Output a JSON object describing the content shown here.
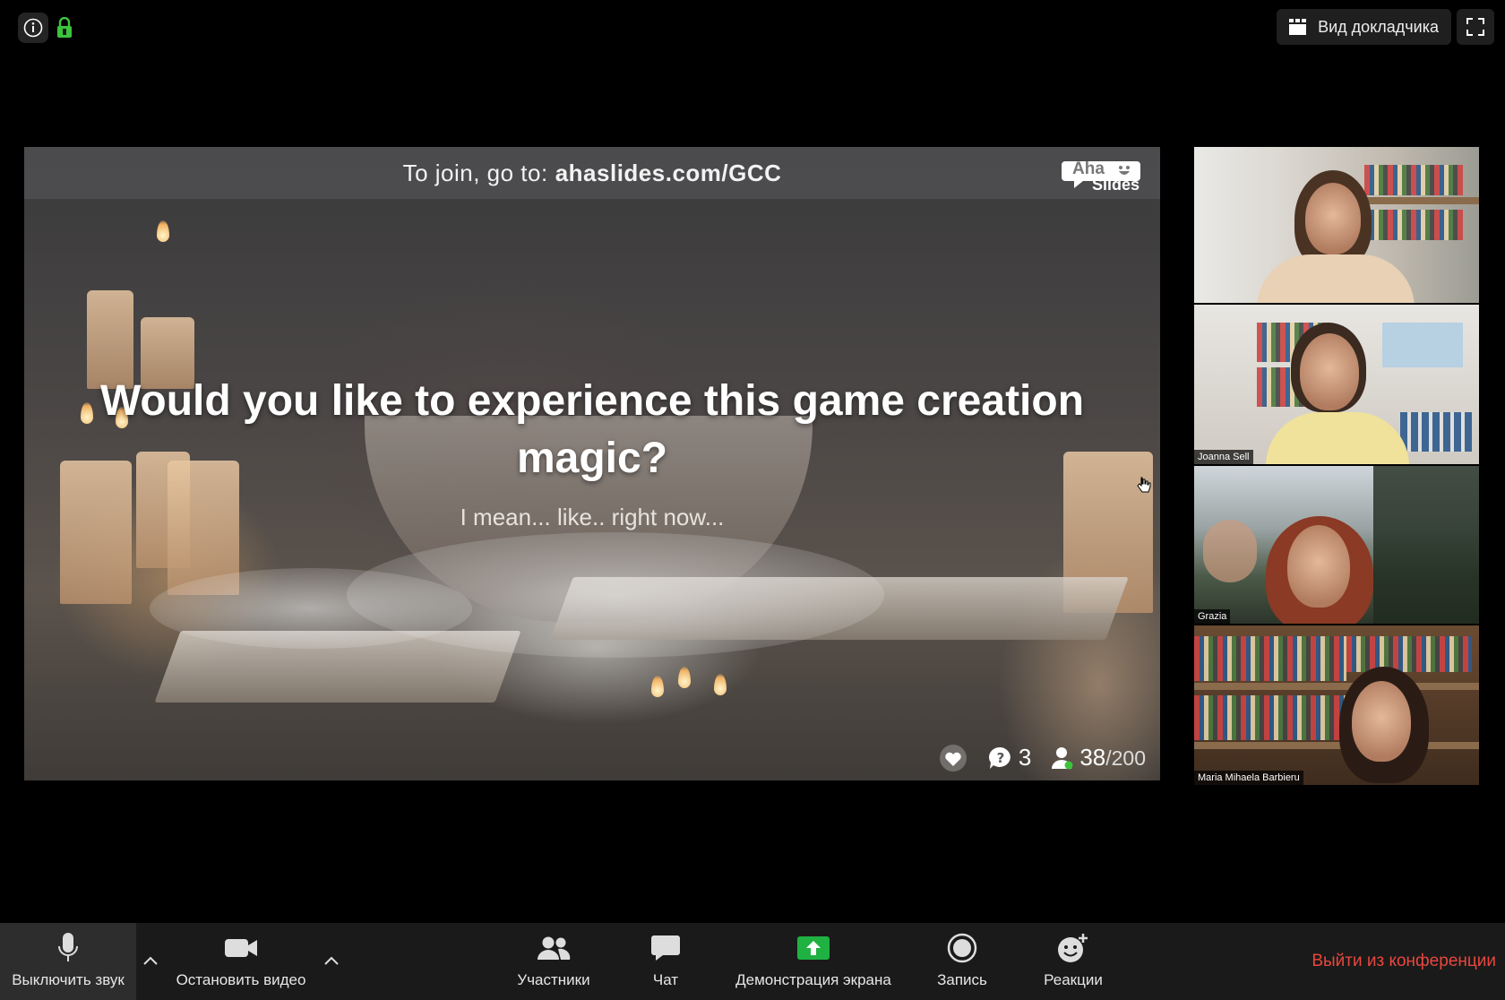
{
  "topbar": {
    "info_icon": "info-icon",
    "lock_icon": "lock-icon",
    "speaker_view_label": "Вид докладчика",
    "fullscreen_icon": "fullscreen-icon"
  },
  "slide": {
    "join_prefix": "To join, go to:",
    "join_url": "ahaslides.com/GCC",
    "logo_line1": "Aha",
    "logo_line2": "Slides",
    "title": "Would you like to experience this game creation magic?",
    "subtitle": "I mean... like.. right now...",
    "questions_count": "3",
    "participants_count": "38",
    "participants_total": "/200"
  },
  "participants": [
    {
      "name": ""
    },
    {
      "name": "Joanna Sell"
    },
    {
      "name": "Grazia"
    },
    {
      "name": "Maria Mihaela Barbieru"
    }
  ],
  "toolbar": {
    "mute_label": "Выключить звук",
    "video_label": "Остановить видео",
    "participants_label": "Участники",
    "chat_label": "Чат",
    "share_label": "Демонстрация экрана",
    "record_label": "Запись",
    "reactions_label": "Реакции",
    "leave_label": "Выйти из конференции"
  },
  "colors": {
    "leave": "#e8473e",
    "share_green": "#1fb141",
    "lock_green": "#3cc43c"
  }
}
